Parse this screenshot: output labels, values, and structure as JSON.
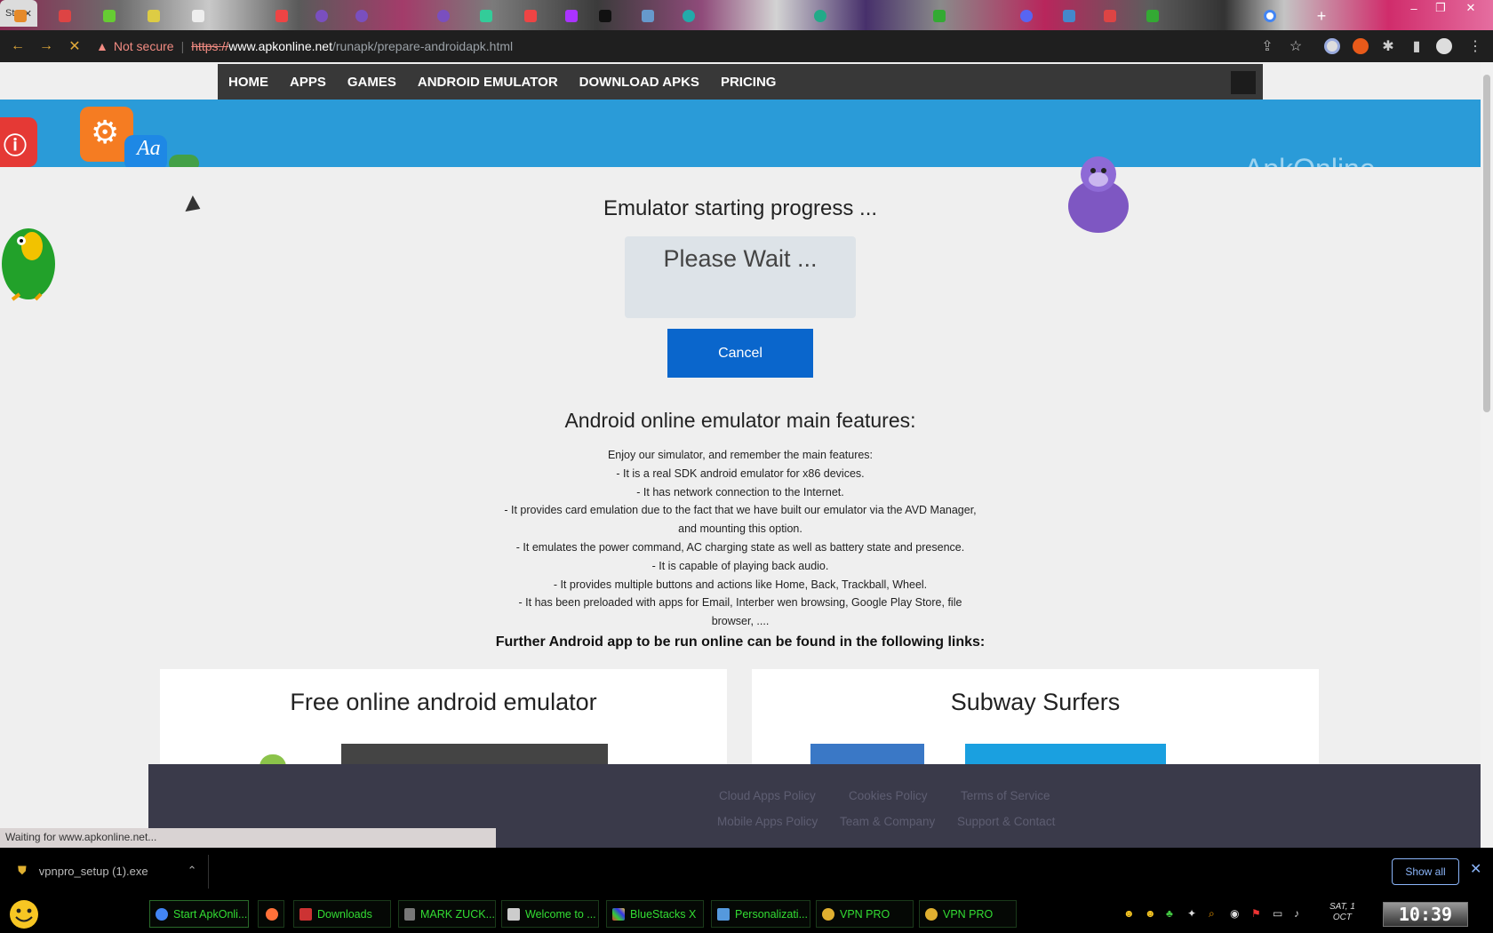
{
  "browser": {
    "active_tab_label": "St",
    "omnibox": {
      "security_label": "Not secure",
      "protocol": "https://",
      "host": "www.apkonline.net",
      "path": "/runapk/prepare-androidapk.html"
    },
    "status_text": "Waiting for www.apkonline.net..."
  },
  "site": {
    "nav": [
      "HOME",
      "APPS",
      "GAMES",
      "ANDROID EMULATOR",
      "DOWNLOAD APKS",
      "PRICING"
    ],
    "banner_text": "ApkOnline"
  },
  "main": {
    "progress_title": "Emulator starting progress ...",
    "wait_text": "Please Wait ...",
    "cancel_label": "Cancel",
    "features_title": "Android online emulator main features:",
    "features": [
      "Enjoy our simulator, and remember the main features:",
      "- It is a real SDK android emulator for x86 devices.",
      "- It has network connection to the Internet.",
      "- It provides card emulation due to the fact that we have built our emulator via the AVD Manager, and mounting this option.",
      "- It emulates the power command, AC charging state as well as battery state and presence.",
      "- It is capable of playing back audio.",
      "- It provides multiple buttons and actions like Home, Back, Trackball, Wheel.",
      "- It has been preloaded with apps for Email, Interber wen browsing, Google Play Store, file browser, ...."
    ],
    "further_links_heading": "Further Android app to be run online can be found in the following links:",
    "cards": [
      "Free online android emulator",
      "Subway Surfers"
    ]
  },
  "footer": {
    "links_row1": [
      "Cloud Apps Policy",
      "Cookies Policy",
      "Terms of Service"
    ],
    "links_row2": [
      "Mobile Apps Policy",
      "Team & Company",
      "Support & Contact"
    ]
  },
  "downloads": {
    "file_name": "vpnpro_setup (1).exe",
    "show_all_label": "Show all"
  },
  "taskbar": {
    "items": [
      "Start ApkOnli...",
      "",
      "Downloads",
      "MARK ZUCK...",
      "Welcome to ...",
      "BlueStacks X",
      "Personalizati...",
      "VPN PRO",
      "VPN PRO"
    ],
    "date_line1": "SAT, 1",
    "date_line2": "OCT",
    "clock": "10:39"
  },
  "colors": {
    "nav_bg": "#383838",
    "banner": "#2a9bd8",
    "cancel_button": "#0a66cc",
    "taskbar_text": "#33dd33"
  }
}
